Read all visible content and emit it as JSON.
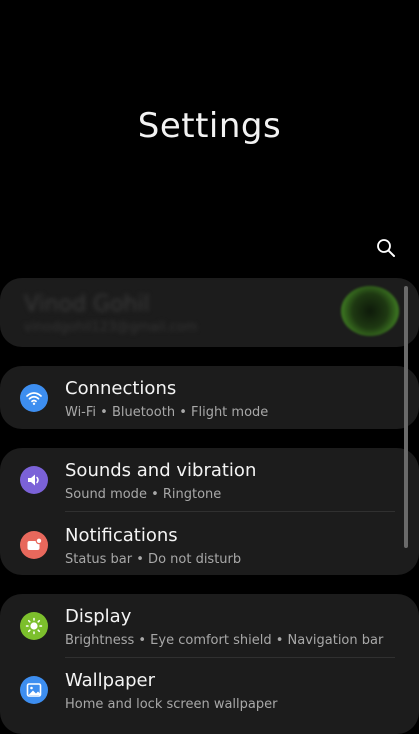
{
  "header": {
    "title": "Settings",
    "search_icon": "search-icon"
  },
  "profile": {
    "name": "Vinod Gohil",
    "email": "vinodgohil123@gmail.com"
  },
  "groups": [
    {
      "items": [
        {
          "title": "Connections",
          "subtitle": "Wi-Fi  •  Bluetooth  •  Flight mode",
          "icon": "wifi-icon",
          "color": "#3d8ef0"
        }
      ]
    },
    {
      "items": [
        {
          "title": "Sounds and vibration",
          "subtitle": "Sound mode  •  Ringtone",
          "icon": "speaker-icon",
          "color": "#7b62d8"
        },
        {
          "title": "Notifications",
          "subtitle": "Status bar  •  Do not disturb",
          "icon": "notification-icon",
          "color": "#e8685c"
        }
      ]
    },
    {
      "items": [
        {
          "title": "Display",
          "subtitle": "Brightness  •  Eye comfort shield  •  Navigation bar",
          "icon": "brightness-icon",
          "color": "#7cbf2c"
        },
        {
          "title": "Wallpaper",
          "subtitle": "Home and lock screen wallpaper",
          "icon": "wallpaper-icon",
          "color": "#3d8ef0"
        }
      ]
    }
  ]
}
